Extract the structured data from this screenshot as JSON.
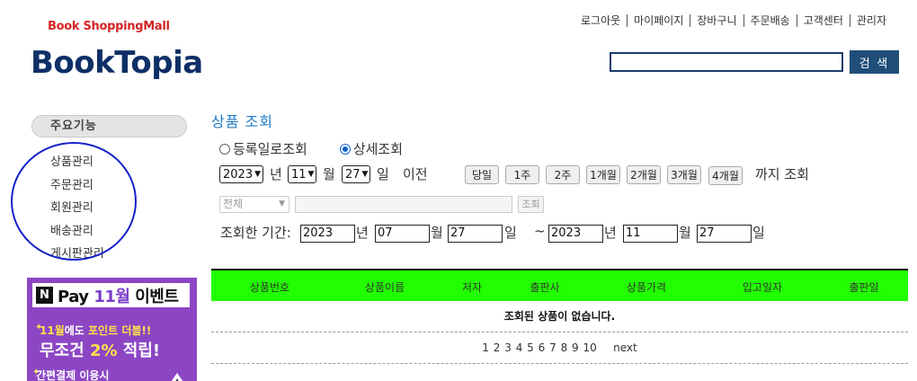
{
  "header": {
    "tagline": "Book ShoppingMall",
    "logo": "BookTopia",
    "nav": [
      "로그아웃",
      "마이페이지",
      "장바구니",
      "주문배송",
      "고객센터",
      "관리자"
    ],
    "search": {
      "value": "",
      "button": "검 색"
    }
  },
  "sidebar": {
    "title": "주요기능",
    "items": [
      "상품관리",
      "주문관리",
      "회원관리",
      "배송관리",
      "게시판관리"
    ]
  },
  "banner": {
    "n_logo": "N",
    "title_pre": "Pay",
    "title_month": "11월",
    "title_post": "이벤트",
    "line1_pre": "11월",
    "line1_mid": "에도 ",
    "line1_hl": "포인트 더블!!",
    "line2_pre": "무조건 ",
    "line2_hl": "2%",
    "line2_post": " 적립!",
    "line3_hl": "간편결제",
    "line3_post": " 이용시"
  },
  "main": {
    "title": "상품 조회",
    "radio": [
      {
        "label": "등록일로조회",
        "checked": false
      },
      {
        "label": "상세조회",
        "checked": true
      }
    ],
    "date": {
      "year": "2023",
      "year_unit": "년",
      "month": "11",
      "month_unit": "월",
      "day": "27",
      "day_unit": "일",
      "before": "이전"
    },
    "quick": [
      "당일",
      "1주",
      "2주",
      "1개월",
      "2개월",
      "3개월",
      "4개월"
    ],
    "until": "까지 조회",
    "filter": {
      "select": "전체",
      "input": "",
      "button": "조회"
    },
    "period": {
      "label": "조회한 기간:",
      "from": {
        "year": "2023",
        "month": "07",
        "day": "27"
      },
      "to": {
        "year": "2023",
        "month": "11",
        "day": "27"
      },
      "y": "년",
      "m": "월",
      "d": "일",
      "tilde": "~"
    },
    "table": {
      "headers": [
        "상품번호",
        "상품이름",
        "저자",
        "출판사",
        "상품가격",
        "입고일자",
        "출판일"
      ],
      "empty": "조회된 상품이 없습니다.",
      "pages": [
        "1",
        "2",
        "3",
        "4",
        "5",
        "6",
        "7",
        "8",
        "9",
        "10"
      ],
      "next": "next"
    }
  },
  "colors": {
    "accent": "#1f4e79",
    "table_header": "#22ff00",
    "title": "#1f79c4",
    "annotation": "#1420c8",
    "banner": "#8c46c4"
  }
}
